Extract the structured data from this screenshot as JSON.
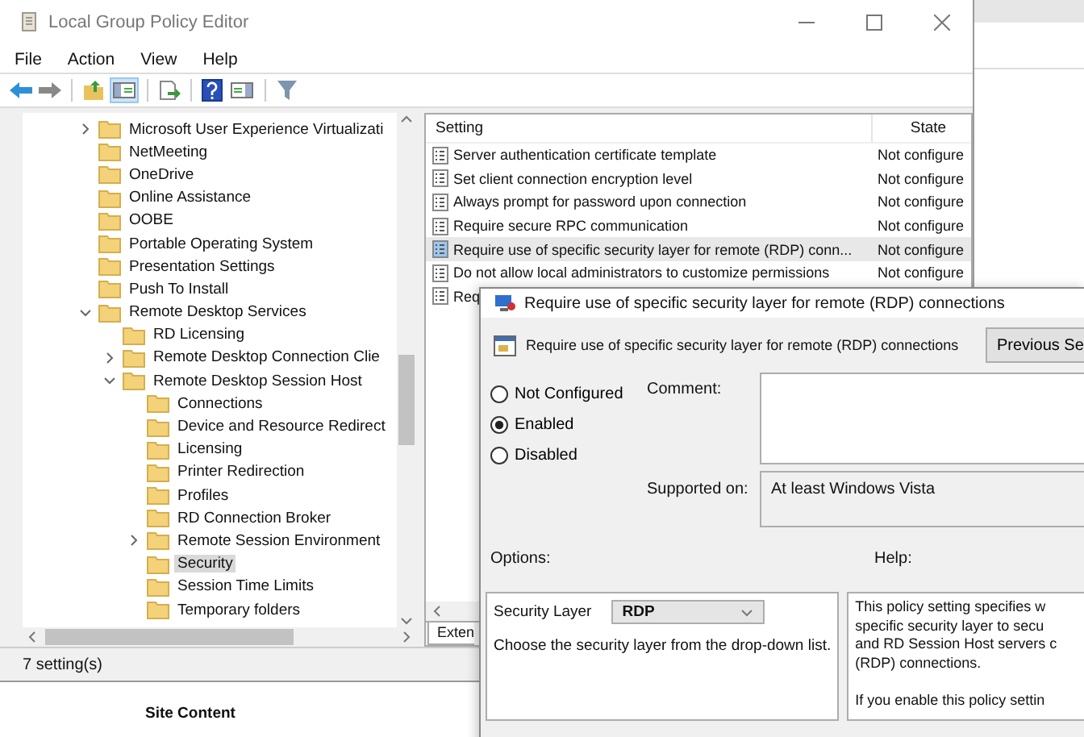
{
  "window": {
    "title": "Local Group Policy Editor"
  },
  "menu": [
    "File",
    "Action",
    "View",
    "Help"
  ],
  "tree": [
    {
      "label": "Microsoft User Experience Virtualizati",
      "expanded": false,
      "selected": false
    },
    {
      "label": "NetMeeting",
      "selected": false
    },
    {
      "label": "OneDrive",
      "selected": false
    },
    {
      "label": "Online Assistance",
      "selected": false
    },
    {
      "label": "OOBE",
      "selected": false
    },
    {
      "label": "Portable Operating System",
      "selected": false
    },
    {
      "label": "Presentation Settings",
      "selected": false
    },
    {
      "label": "Push To Install",
      "selected": false
    },
    {
      "label": "Remote Desktop Services",
      "expanded": true,
      "selected": false,
      "children": [
        {
          "label": "RD Licensing",
          "selected": false
        },
        {
          "label": "Remote Desktop Connection Clie",
          "expanded": false,
          "selected": false
        },
        {
          "label": "Remote Desktop Session Host",
          "expanded": true,
          "selected": false,
          "children": [
            {
              "label": "Connections",
              "selected": false
            },
            {
              "label": "Device and Resource Redirect",
              "selected": false
            },
            {
              "label": "Licensing",
              "selected": false
            },
            {
              "label": "Printer Redirection",
              "selected": false
            },
            {
              "label": "Profiles",
              "selected": false
            },
            {
              "label": "RD Connection Broker",
              "selected": false
            },
            {
              "label": "Remote Session Environment",
              "expanded": false,
              "selected": false
            },
            {
              "label": "Security",
              "selected": true
            },
            {
              "label": "Session Time Limits",
              "selected": false
            },
            {
              "label": "Temporary folders",
              "selected": false
            }
          ]
        }
      ]
    }
  ],
  "settings": {
    "columns": [
      "Setting",
      "State"
    ],
    "rows": [
      {
        "setting": "Server authentication certificate template",
        "state": "Not configure",
        "selected": false
      },
      {
        "setting": "Set client connection encryption level",
        "state": "Not configure",
        "selected": false
      },
      {
        "setting": "Always prompt for password upon connection",
        "state": "Not configure",
        "selected": false
      },
      {
        "setting": "Require secure RPC communication",
        "state": "Not configure",
        "selected": false
      },
      {
        "setting": "Require use of specific security layer for remote (RDP) conn...",
        "state": "Not configure",
        "selected": true
      },
      {
        "setting": "Do not allow local administrators to customize permissions",
        "state": "Not configure",
        "selected": false
      },
      {
        "setting": "Req",
        "selected": false
      }
    ],
    "tab": "Exten"
  },
  "status_bar": "7 setting(s)",
  "background_page": {
    "heading": "Site Content"
  },
  "dialog": {
    "title": "Require use of specific security layer for remote (RDP) connections",
    "heading": "Require use of specific security layer for remote (RDP) connections",
    "previous_button": "Previous Se",
    "radios": [
      {
        "label": "Not Configured",
        "selected": false
      },
      {
        "label": "Enabled",
        "selected": true
      },
      {
        "label": "Disabled",
        "selected": false
      }
    ],
    "comment_label": "Comment:",
    "supported_label": "Supported on:",
    "supported_value": "At least Windows Vista",
    "options_label": "Options:",
    "help_label": "Help:",
    "option": {
      "label": "Security Layer",
      "value": "RDP",
      "description": "Choose the security layer from the drop-down list."
    },
    "help_paragraphs": [
      [
        "This policy setting specifies w",
        "specific security layer to secu",
        "and RD Session Host servers c",
        "(RDP) connections."
      ],
      [
        "If you enable this policy settin"
      ]
    ]
  }
}
